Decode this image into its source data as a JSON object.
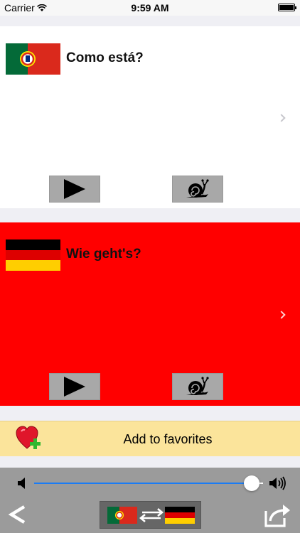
{
  "status_bar": {
    "carrier": "Carrier",
    "time": "9:59 AM"
  },
  "source_card": {
    "language": "Portuguese",
    "phrase": "Como está?"
  },
  "target_card": {
    "language": "German",
    "phrase": "Wie geht's?"
  },
  "favorites": {
    "label": "Add to favorites"
  },
  "audio": {
    "volume": 0.95
  },
  "colors": {
    "target_background": "#ff0000",
    "favorites_background": "#fbe49b",
    "slider_fill": "#1a7cf5",
    "toolbar": "#9b9b9b"
  },
  "icons": [
    "wifi-icon",
    "battery-icon",
    "portugal-flag-icon",
    "germany-flag-icon",
    "play-icon",
    "snail-icon",
    "chevron-right-icon",
    "heart-plus-icon",
    "speaker-low-icon",
    "speaker-high-icon",
    "back-icon",
    "swap-arrows-icon",
    "share-icon"
  ]
}
